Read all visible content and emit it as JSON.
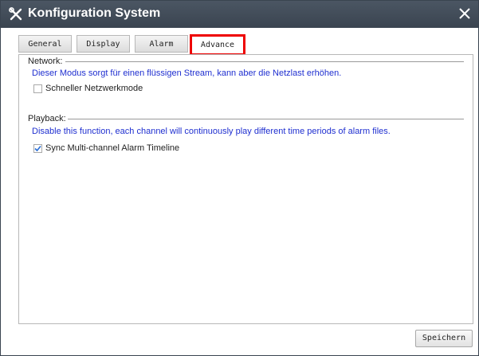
{
  "window": {
    "title": "Konfiguration System",
    "title_icon": "tools-icon",
    "close_icon": "close-icon"
  },
  "tabs": [
    {
      "label": "General",
      "active": false
    },
    {
      "label": "Display",
      "active": false
    },
    {
      "label": "Alarm",
      "active": false
    },
    {
      "label": "Advance",
      "active": true
    }
  ],
  "network": {
    "label": "Network:",
    "description": "Dieser Modus sorgt für einen flüssigen Stream, kann aber die Netzlast erhöhen.",
    "option_label": "Schneller Netzwerkmode",
    "option_checked": false
  },
  "playback": {
    "label": "Playback:",
    "description": "Disable this function, each channel will continuously play different time periods of alarm files.",
    "option_label": "Sync Multi-channel Alarm Timeline",
    "option_checked": true
  },
  "footer": {
    "save_label": "Speichern"
  },
  "colors": {
    "titlebar": "#3a4450",
    "description_text": "#1f2fd0",
    "active_tab_highlight": "#ee0000",
    "check_mark": "#2a6fd6"
  }
}
